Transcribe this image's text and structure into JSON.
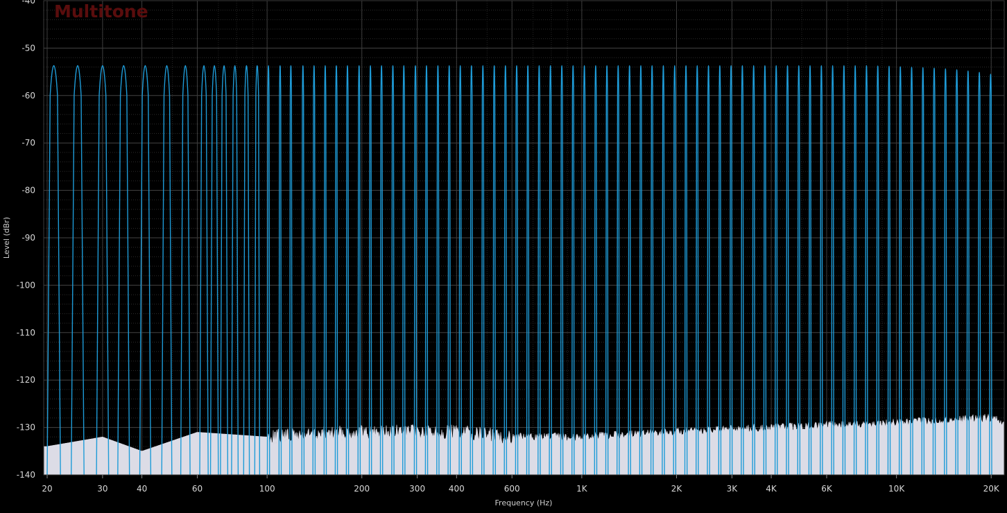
{
  "chart_data": {
    "type": "line",
    "title": "Multitone",
    "xlabel": "Frequency (Hz)",
    "ylabel": "Level (dBr)",
    "x_scale": "log",
    "xlim": [
      19.5,
      22000
    ],
    "ylim": [
      -140,
      -40
    ],
    "grid": true,
    "x_ticks": [
      {
        "value": 20,
        "label": "20"
      },
      {
        "value": 30,
        "label": "30"
      },
      {
        "value": 40,
        "label": "40"
      },
      {
        "value": 60,
        "label": "60"
      },
      {
        "value": 100,
        "label": "100"
      },
      {
        "value": 200,
        "label": "200"
      },
      {
        "value": 300,
        "label": "300"
      },
      {
        "value": 400,
        "label": "400"
      },
      {
        "value": 600,
        "label": "600"
      },
      {
        "value": 1000,
        "label": "1K"
      },
      {
        "value": 2000,
        "label": "2K"
      },
      {
        "value": 3000,
        "label": "3K"
      },
      {
        "value": 4000,
        "label": "4K"
      },
      {
        "value": 6000,
        "label": "6K"
      },
      {
        "value": 10000,
        "label": "10K"
      },
      {
        "value": 20000,
        "label": "20K"
      }
    ],
    "y_ticks": [
      {
        "value": -40,
        "label": "-40"
      },
      {
        "value": -50,
        "label": "-50"
      },
      {
        "value": -60,
        "label": "-60"
      },
      {
        "value": -70,
        "label": "-70"
      },
      {
        "value": -80,
        "label": "-80"
      },
      {
        "value": -90,
        "label": "-90"
      },
      {
        "value": -100,
        "label": "-100"
      },
      {
        "value": -110,
        "label": "-110"
      },
      {
        "value": -120,
        "label": "-120"
      },
      {
        "value": -130,
        "label": "-130"
      },
      {
        "value": -140,
        "label": "-140"
      }
    ],
    "series": [
      {
        "color": "#1e9bd7",
        "kind": "tone-peaks",
        "tone_frequencies_hz": [
          21,
          25,
          30,
          35,
          41,
          48,
          55,
          63,
          68,
          73,
          79,
          86,
          93,
          101,
          110,
          119,
          130,
          141,
          153,
          166,
          180,
          196,
          213,
          231,
          251,
          272,
          296,
          321,
          349,
          379,
          411,
          446,
          485,
          527,
          572,
          621,
          674,
          732,
          795,
          864,
          938,
          1019,
          1107,
          1202,
          1305,
          1418,
          1540,
          1672,
          1816,
          1973,
          2143,
          2327,
          2527,
          2745,
          2981,
          3238,
          3517,
          3819,
          4148,
          4505,
          4893,
          5314,
          5772,
          6269,
          6808,
          7394,
          8031,
          8722,
          9473,
          10288,
          11173,
          12135,
          13179,
          14314,
          15546,
          16884,
          18337,
          19916
        ],
        "peak_levels_dbr": [
          -48,
          -48,
          -48,
          -48,
          -48,
          -48,
          -48,
          -48,
          -48,
          -48,
          -48,
          -48,
          -48,
          -48,
          -48,
          -48,
          -48,
          -48,
          -48,
          -48,
          -48,
          -48,
          -48,
          -48,
          -48,
          -48,
          -48,
          -48,
          -48,
          -48,
          -48,
          -48,
          -48,
          -48,
          -48,
          -48,
          -48,
          -48,
          -48,
          -48,
          -48,
          -48,
          -48,
          -48,
          -48,
          -48,
          -48,
          -48,
          -48,
          -48,
          -48,
          -48,
          -48,
          -48,
          -48,
          -48,
          -48,
          -48,
          -48,
          -48,
          -48,
          -48,
          -48,
          -48,
          -48,
          -48,
          -48,
          -48.1,
          -48.2,
          -48.4,
          -48.6,
          -48.8,
          -49.0,
          -49.3,
          -49.7,
          -50.2,
          -50.8,
          -51.6
        ]
      },
      {
        "color": "#dcdce6",
        "kind": "noise-floor",
        "x": [
          20,
          30,
          40,
          60,
          100,
          200,
          400,
          600,
          1000,
          2000,
          4000,
          10000,
          20000,
          22000
        ],
        "y": [
          -134,
          -132,
          -135,
          -131,
          -132,
          -131,
          -131,
          -132,
          -132,
          -131,
          -130,
          -129,
          -128,
          -129
        ]
      }
    ]
  }
}
